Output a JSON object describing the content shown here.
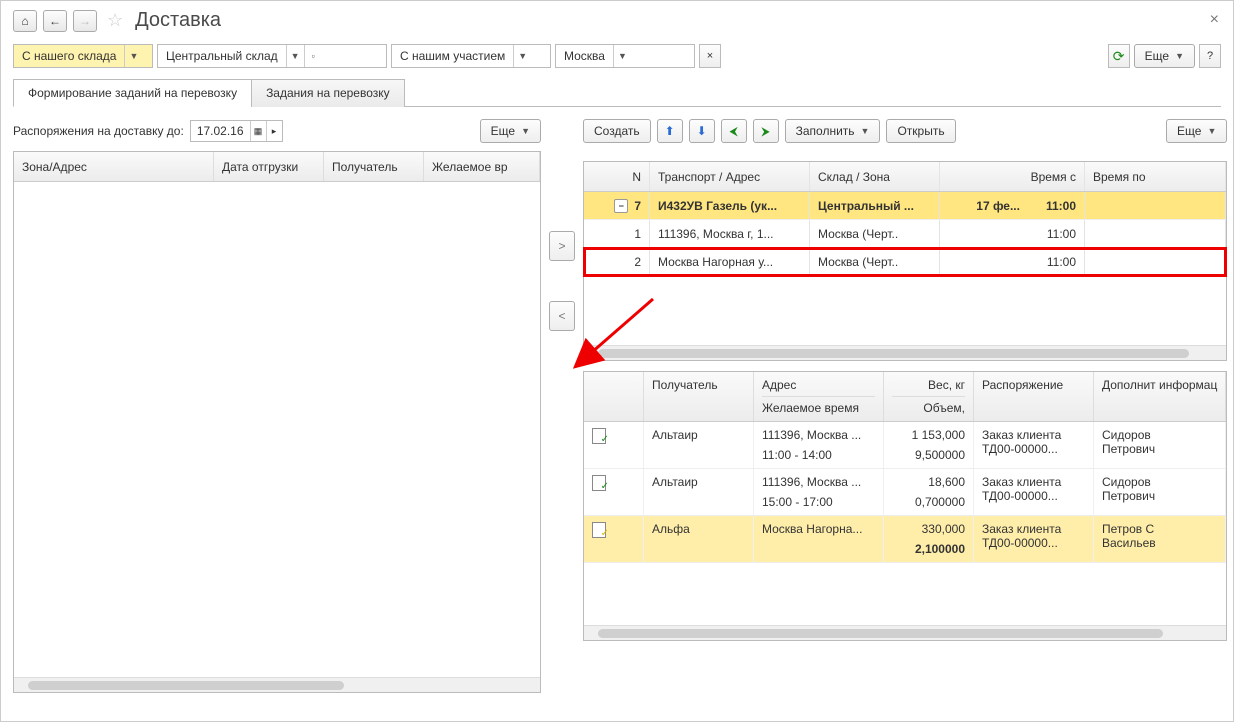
{
  "title": "Доставка",
  "toolbar": {
    "origin": "С нашего склада",
    "warehouse": "Центральный склад",
    "participation": "С нашим участием",
    "city": "Москва",
    "more_label": "Еще"
  },
  "tabs": {
    "form": "Формирование заданий на перевозку",
    "tasks": "Задания на перевозку"
  },
  "left": {
    "until_label": "Распоряжения на доставку до:",
    "date": "17.02.16",
    "more_label": "Еще",
    "cols": {
      "zone": "Зона/Адрес",
      "ship": "Дата отгрузки",
      "recv": "Получатель",
      "wish": "Желаемое вр"
    }
  },
  "right": {
    "create": "Создать",
    "fill": "Заполнить",
    "open": "Открыть",
    "more": "Еще"
  },
  "t1": {
    "cols": {
      "n": "N",
      "tr": "Транспорт / Адрес",
      "sk": "Склад / Зона",
      "vc": "Время с",
      "vp": "Время по"
    },
    "group": {
      "n": "7",
      "tr": "И432УВ Газель (ук...",
      "sk": "Центральный ...",
      "date": "17 фе...",
      "time": "11:00"
    },
    "rows": [
      {
        "n": "1",
        "tr": "111396, Москва г, 1...",
        "sk": "Москва (Черт..",
        "time": "11:00"
      },
      {
        "n": "2",
        "tr": "Москва Нагорная у...",
        "sk": "Москва (Черт..",
        "time": "11:00"
      }
    ]
  },
  "t2": {
    "cols": {
      "recv": "Получатель",
      "adr": "Адрес",
      "wish": "Желаемое время",
      "wkg": "Вес, кг",
      "vol": "Объем,",
      "ord": "Распоряжение",
      "dop": "Дополнит информац"
    },
    "rows": [
      {
        "recv": "Альтаир",
        "adr": "111396, Москва ...",
        "wish": "11:00 - 14:00",
        "w": "1 153,000",
        "v": "9,500000",
        "ord1": "Заказ клиента",
        "ord2": "ТД00-00000...",
        "dop1": "Сидоров",
        "dop2": "Петрович"
      },
      {
        "recv": "Альтаир",
        "adr": "111396, Москва ...",
        "wish": "15:00 - 17:00",
        "w": "18,600",
        "v": "0,700000",
        "ord1": "Заказ клиента",
        "ord2": "ТД00-00000...",
        "dop1": "Сидоров",
        "dop2": "Петрович"
      },
      {
        "recv": "Альфа",
        "adr": "Москва Нагорна...",
        "wish": "",
        "w": "330,000",
        "v": "2,100000",
        "ord1": "Заказ клиента",
        "ord2": "ТД00-00000...",
        "dop1": "Петров С",
        "dop2": "Васильев"
      }
    ]
  }
}
